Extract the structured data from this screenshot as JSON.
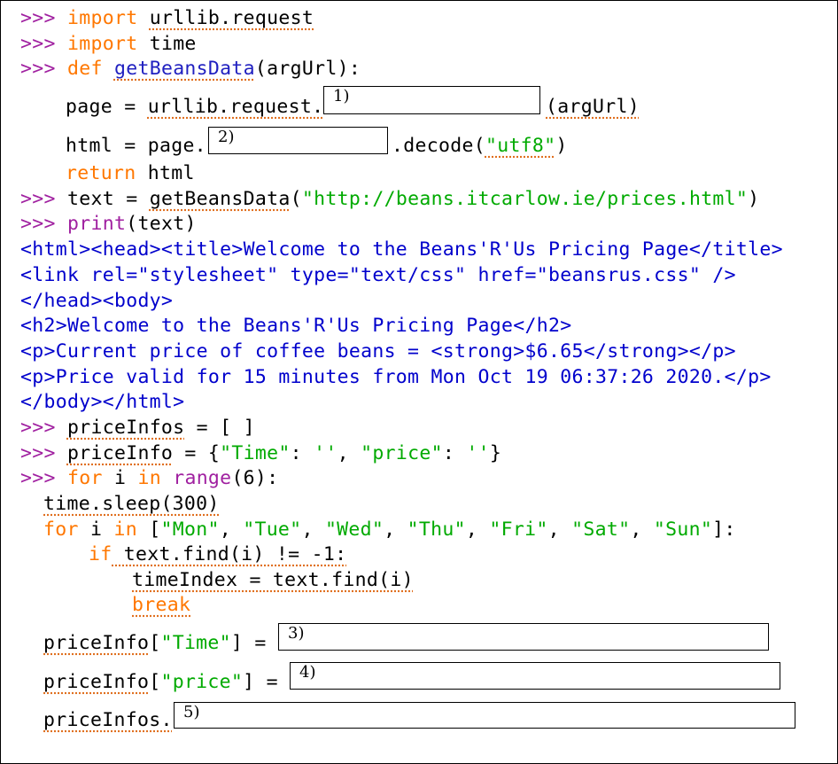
{
  "prompt": ">>> ",
  "blanks": [
    "1)",
    "2)",
    "3)",
    "4)",
    "5)"
  ],
  "code": {
    "l1": [
      "import",
      "urllib.request"
    ],
    "l2": [
      "import",
      "time"
    ],
    "l3": [
      "def",
      "getBeansData",
      "(argUrl):"
    ],
    "l4": [
      "page = ",
      "urllib.request.",
      "(argUrl)"
    ],
    "l5": [
      "html = page.",
      ".decode(",
      "\"utf8\"",
      ")"
    ],
    "l6": [
      "return",
      "html"
    ],
    "l7": [
      "text = ",
      "getBeansData",
      "(",
      "\"http://beans.itcarlow.ie/prices.html\"",
      ")"
    ],
    "l8": [
      "print",
      "(text)"
    ]
  },
  "output": [
    "<html><head><title>Welcome to the Beans'R'Us Pricing Page</title>",
    "<link rel=\"stylesheet\" type=\"text/css\" href=\"beansrus.css\" />",
    "</head><body>",
    "<h2>Welcome to the Beans'R'Us Pricing Page</h2>",
    "<p>Current price of coffee beans = <strong>$6.65</strong></p>",
    "<p>Price valid for 15 minutes from Mon Oct 19 06:37:26 2020.</p>",
    "</body></html>"
  ],
  "code2": {
    "l16": [
      "priceInfos",
      " = [ ]"
    ],
    "l17": [
      "priceInfo",
      " = {",
      "\"Time\"",
      ": ",
      "''",
      ", ",
      "\"price\"",
      ": ",
      "''",
      "}"
    ],
    "l18": [
      "for",
      " i ",
      "in",
      " ",
      "range",
      "(6):"
    ],
    "l19": "time.sleep(300)",
    "l20": [
      "for",
      " i ",
      "in",
      " [",
      "\"Mon\"",
      ", ",
      "\"Tue\"",
      ", ",
      "\"Wed\"",
      ", ",
      "\"Thu\"",
      ", ",
      "\"Fri\"",
      ", ",
      "\"Sat\"",
      ", ",
      "\"Sun\"",
      "]:"
    ],
    "l21": [
      "if",
      " text.find(i) != -1:"
    ],
    "l22": "timeIndex = text.find(i)",
    "l23": "break",
    "l24": [
      "priceInfo",
      "[",
      "\"Time\"",
      "] = "
    ],
    "l25": [
      "priceInfo",
      "[",
      "\"price\"",
      "] = "
    ],
    "l26": "priceInfos."
  }
}
